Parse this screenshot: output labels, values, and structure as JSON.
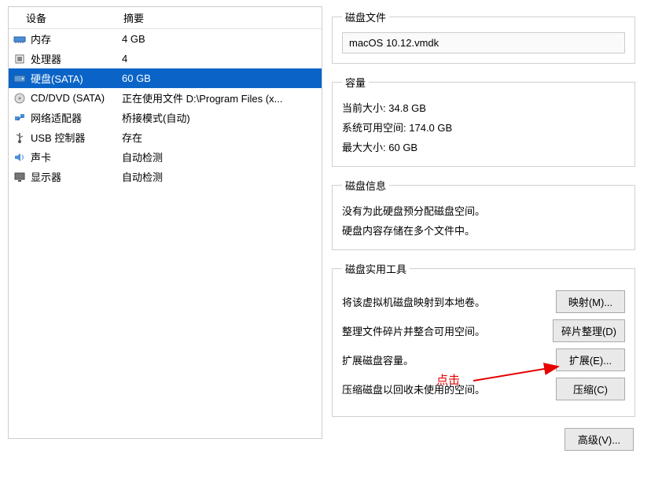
{
  "columns": {
    "device": "设备",
    "summary": "摘要"
  },
  "devices": [
    {
      "name": "内存",
      "summary": "4 GB",
      "icon": "memory"
    },
    {
      "name": "处理器",
      "summary": "4",
      "icon": "cpu"
    },
    {
      "name": "硬盘(SATA)",
      "summary": "60 GB",
      "icon": "hdd",
      "selected": true
    },
    {
      "name": "CD/DVD (SATA)",
      "summary": "正在使用文件 D:\\Program Files (x...",
      "icon": "cd"
    },
    {
      "name": "网络适配器",
      "summary": "桥接模式(自动)",
      "icon": "net"
    },
    {
      "name": "USB 控制器",
      "summary": "存在",
      "icon": "usb"
    },
    {
      "name": "声卡",
      "summary": "自动检测",
      "icon": "sound"
    },
    {
      "name": "显示器",
      "summary": "自动检测",
      "icon": "display"
    }
  ],
  "diskFile": {
    "legend": "磁盘文件",
    "value": "macOS 10.12.vmdk"
  },
  "capacity": {
    "legend": "容量",
    "currentLabel": "当前大小:",
    "currentValue": "34.8 GB",
    "freeLabel": "系统可用空间:",
    "freeValue": "174.0 GB",
    "maxLabel": "最大大小:",
    "maxValue": "60 GB"
  },
  "diskInfo": {
    "legend": "磁盘信息",
    "line1": "没有为此硬盘预分配磁盘空间。",
    "line2": "硬盘内容存储在多个文件中。"
  },
  "utilities": {
    "legend": "磁盘实用工具",
    "mapDesc": "将该虚拟机磁盘映射到本地卷。",
    "mapBtn": "映射(M)...",
    "defragDesc": "整理文件碎片并整合可用空间。",
    "defragBtn": "碎片整理(D)",
    "expandDesc": "扩展磁盘容量。",
    "expandBtn": "扩展(E)...",
    "compactDesc": "压缩磁盘以回收未使用的空间。",
    "compactBtn": "压缩(C)"
  },
  "advancedBtn": "高级(V)...",
  "annotation": "点击"
}
